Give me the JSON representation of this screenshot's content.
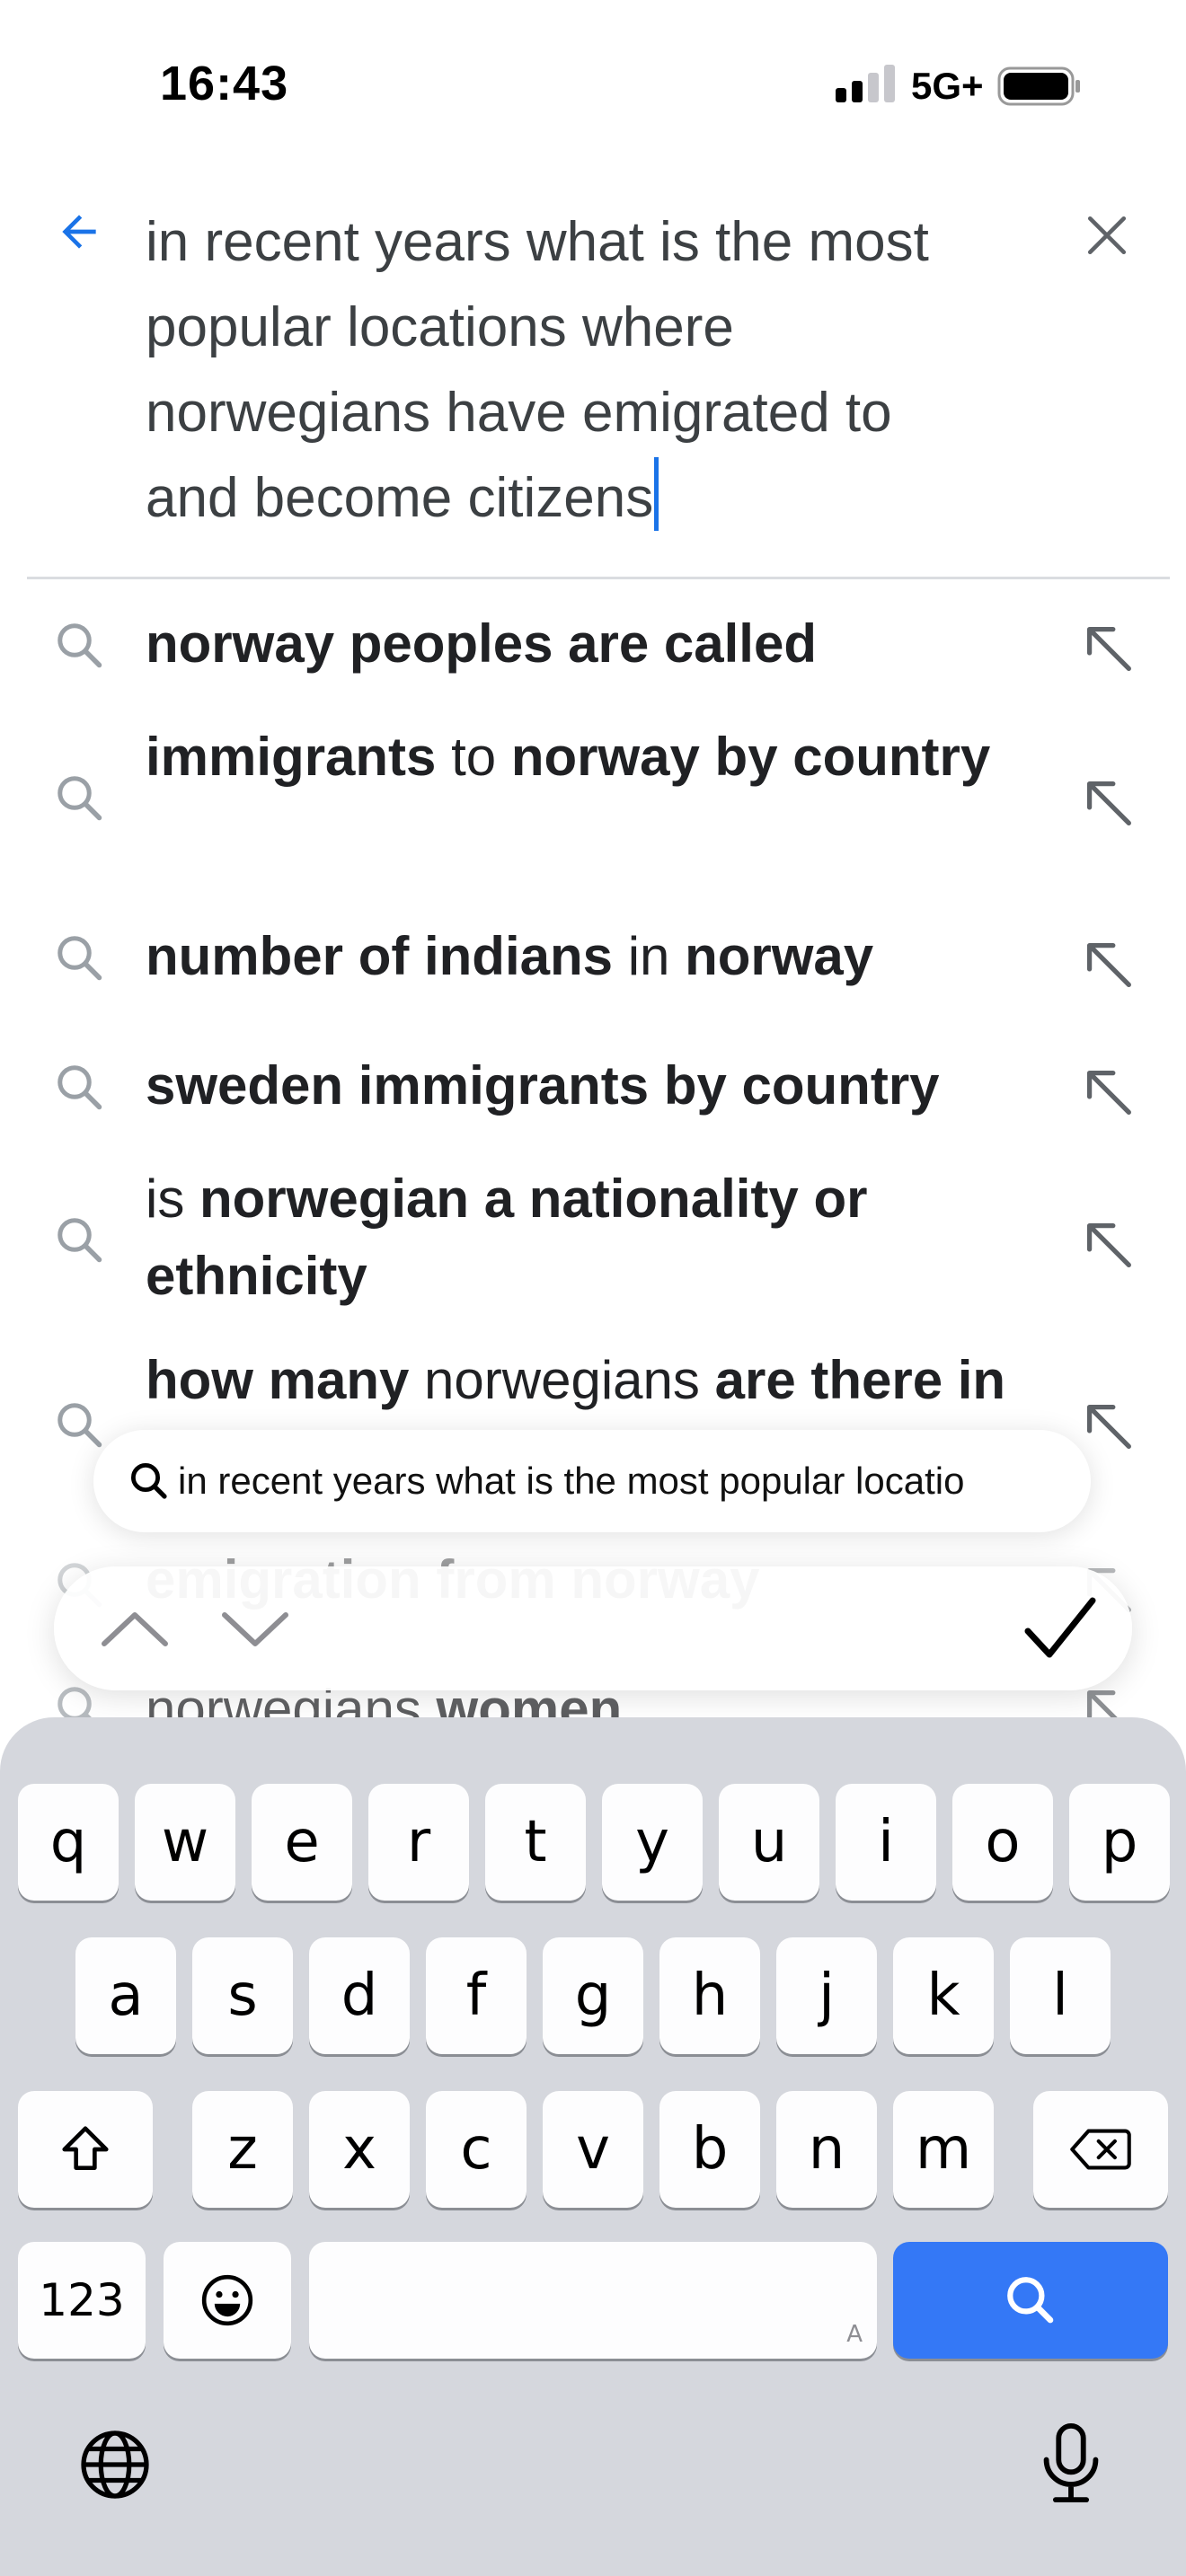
{
  "status_bar": {
    "time": "16:43",
    "network": "5G+"
  },
  "search": {
    "query": "in recent years what is the most popular locations where norwegians have emigrated to and become citizens"
  },
  "suggestions": [
    {
      "parts": [
        {
          "t": "norway peoples are called",
          "b": true
        }
      ]
    },
    {
      "parts": [
        {
          "t": "immigrants",
          "b": true
        },
        {
          "t": " to ",
          "b": false
        },
        {
          "t": "norway by country",
          "b": true
        }
      ]
    },
    {
      "parts": [
        {
          "t": "number of indians",
          "b": true
        },
        {
          "t": " in ",
          "b": false
        },
        {
          "t": "norway",
          "b": true
        }
      ]
    },
    {
      "parts": [
        {
          "t": "sweden immigrants by country",
          "b": true
        }
      ]
    },
    {
      "parts": [
        {
          "t": "is ",
          "b": false
        },
        {
          "t": "norwegian a nationality or ethnicity",
          "b": true
        }
      ]
    },
    {
      "parts": [
        {
          "t": "how many",
          "b": true
        },
        {
          "t": " norwegians ",
          "b": false
        },
        {
          "t": "are there in the world",
          "b": true
        }
      ]
    },
    {
      "parts": [
        {
          "t": "emigration from norway",
          "b": true
        }
      ]
    },
    {
      "parts": [
        {
          "t": "norwegians ",
          "b": false
        },
        {
          "t": "women",
          "b": true
        }
      ]
    }
  ],
  "find_bar": {
    "query": "in recent years what is the most popular locatio"
  },
  "keyboard": {
    "row1": [
      "q",
      "w",
      "e",
      "r",
      "t",
      "y",
      "u",
      "i",
      "o",
      "p"
    ],
    "row2": [
      "a",
      "s",
      "d",
      "f",
      "g",
      "h",
      "j",
      "k",
      "l"
    ],
    "row3": [
      "z",
      "x",
      "c",
      "v",
      "b",
      "n",
      "m"
    ],
    "numbers_label": "123",
    "space_hint": "A"
  },
  "colors": {
    "accent": "#1a73e8",
    "key_search": "#3478f6"
  }
}
